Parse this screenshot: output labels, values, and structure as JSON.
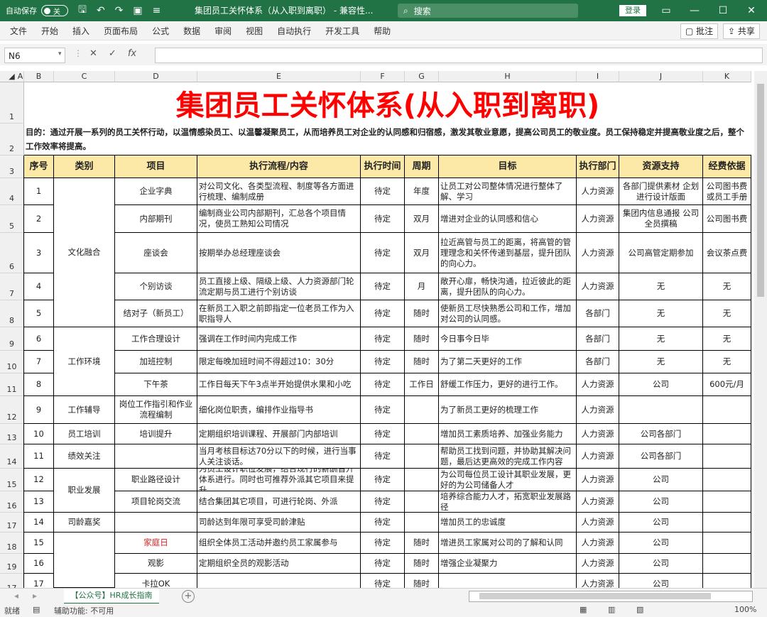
{
  "titlebar": {
    "autosave_label": "自动保存",
    "autosave_state": "关",
    "doc_title": "集团员工关怀体系（从入职到离职） - 兼容性...",
    "search_placeholder": "搜索",
    "login_label": "登录"
  },
  "menu": {
    "items": [
      "文件",
      "开始",
      "插入",
      "页面布局",
      "公式",
      "数据",
      "审阅",
      "视图",
      "自动执行",
      "开发工具",
      "帮助"
    ],
    "comment_label": "批注",
    "share_label": "共享"
  },
  "formula": {
    "namebox": "N6",
    "fx": "fx"
  },
  "columns": [
    "A",
    "B",
    "C",
    "D",
    "E",
    "F",
    "G",
    "H",
    "I",
    "J",
    "K"
  ],
  "rows": [
    "1",
    "2",
    "3",
    "4",
    "5",
    "6",
    "7",
    "8",
    "9",
    "10",
    "11",
    "12",
    "13",
    "14",
    "15",
    "16",
    "17",
    "18",
    "19",
    "17"
  ],
  "sheet": {
    "title": "集团员工关怀体系(从入职到离职)",
    "purpose": "目的：通过开展一系列的员工关怀行动，以温情感染员工、以温馨凝聚员工，从而培养员工对企业的认同感和归宿感，激发其敬业意愿，提高公司员工的敬业度。员工保持稳定并提高敬业度之后，整个工作效率将提高。",
    "headers": [
      "序号",
      "类别",
      "项目",
      "执行流程/内容",
      "执行时间",
      "周期",
      "目标",
      "执行部门",
      "资源支持",
      "经费依据"
    ],
    "groups": [
      "文化融合",
      "工作环境",
      "工作辅导",
      "员工培训",
      "绩效关注",
      "职业发展",
      "司龄嘉奖"
    ],
    "data": [
      [
        "1",
        "企业字典",
        "对公司文化、各类型流程、制度等各方面进行梳理、编制成册",
        "待定",
        "年度",
        "让员工对公司整体情况进行整体了解、学习",
        "人力资源",
        "各部门提供素材 企划进行设计版面",
        "公司图书费或员工手册"
      ],
      [
        "2",
        "内部期刊",
        "编制商业公司内部期刊，汇总各个项目情况，使员工熟知公司情况",
        "待定",
        "双月",
        "增进对企业的认同感和信心",
        "人力资源",
        "集团内信息通报 公司全员撰稿",
        "公司图书费"
      ],
      [
        "3",
        "座谈会",
        "按期举办总经理座谈会",
        "待定",
        "双月",
        "拉近高管与员工的距离，将高管的管理理念和关怀传递到基层，提升团队的向心力。",
        "人力资源",
        "公司高管定期参加",
        "会议茶点费"
      ],
      [
        "4",
        "个别访谈",
        "员工直接上级、隔级上级、人力资源部门轮流定期与员工进行个别访谈",
        "待定",
        "月",
        "敞开心扉，畅快沟通，拉近彼此的距离，提升团队的向心力。",
        "人力资源",
        "无",
        "无"
      ],
      [
        "5",
        "结对子（新员工）",
        "在新员工入职之前即指定一位老员工作为入职指导人",
        "待定",
        "随时",
        "使新员工尽快熟悉公司和工作，增加对公司的认同感。",
        "各部门",
        "无",
        "无"
      ],
      [
        "6",
        "工作合理设计",
        "强调在工作时间内完成工作",
        "待定",
        "随时",
        "今日事今日毕",
        "各部门",
        "无",
        "无"
      ],
      [
        "7",
        "加班控制",
        "限定每晚加班时间不得超过10：30分",
        "待定",
        "随时",
        "为了第二天更好的工作",
        "各部门",
        "无",
        "无"
      ],
      [
        "8",
        "下午茶",
        "工作日每天下午3点半开始提供水果和小吃",
        "待定",
        "工作日",
        "舒缓工作压力，更好的进行工作。",
        "人力资源",
        "公司",
        "600元/月"
      ],
      [
        "9",
        "岗位工作指引和作业流程编制",
        "细化岗位职责，编排作业指导书",
        "待定",
        "",
        "为了新员工更好的梳理工作",
        "人力资源",
        "",
        ""
      ],
      [
        "10",
        "培训提升",
        "定期组织培训课程、开展部门内部培训",
        "待定",
        "",
        "增加员工素质培养、加强业务能力",
        "人力资源",
        "公司各部门",
        ""
      ],
      [
        "11",
        "",
        "当月考核目标达70分以下的时候，进行当事人关注谈话。",
        "待定",
        "",
        "帮助员工找到问题，并协助其解决问题，最后达更高效的完成工作内容",
        "人力资源",
        "公司各部门",
        ""
      ],
      [
        "12",
        "职业路径设计",
        "为员工设计职位发展，结合现行的薪酬晋升体系进行。同时也可推荐外派其它项目来提升。",
        "待定",
        "",
        "为公司每位员工设计其职业发展，更好的为公司储备人才",
        "人力资源",
        "公司",
        ""
      ],
      [
        "13",
        "项目轮岗交流",
        "结合集团其它项目，可进行轮岗、外派",
        "待定",
        "",
        "培养综合能力人才，拓宽职业发展路径",
        "人力资源",
        "公司",
        ""
      ],
      [
        "14",
        "",
        "司龄达到年限可享受司龄津贴",
        "待定",
        "",
        "增加员工的忠诚度",
        "人力资源",
        "公司",
        ""
      ],
      [
        "15",
        "家庭日",
        "组织全体员工活动并邀约员工家属参与",
        "待定",
        "随时",
        "增进员工家属对公司的了解和认同",
        "人力资源",
        "公司",
        ""
      ],
      [
        "16",
        "观影",
        "定期组织全员的观影活动",
        "待定",
        "随时",
        "增强企业凝聚力",
        "人力资源",
        "公司",
        ""
      ],
      [
        "17",
        "卡拉OK",
        "",
        "待定",
        "随时",
        "",
        "人力资源",
        "公司",
        ""
      ]
    ]
  },
  "sheet_tab": "【公众号】HR成长指南",
  "status": {
    "ready": "就绪",
    "accessibility": "辅助功能: 不可用",
    "zoom": "100%"
  },
  "colors": {
    "accent": "#217346",
    "header_fill": "#fde9a7",
    "title_red": "#ff0000"
  }
}
